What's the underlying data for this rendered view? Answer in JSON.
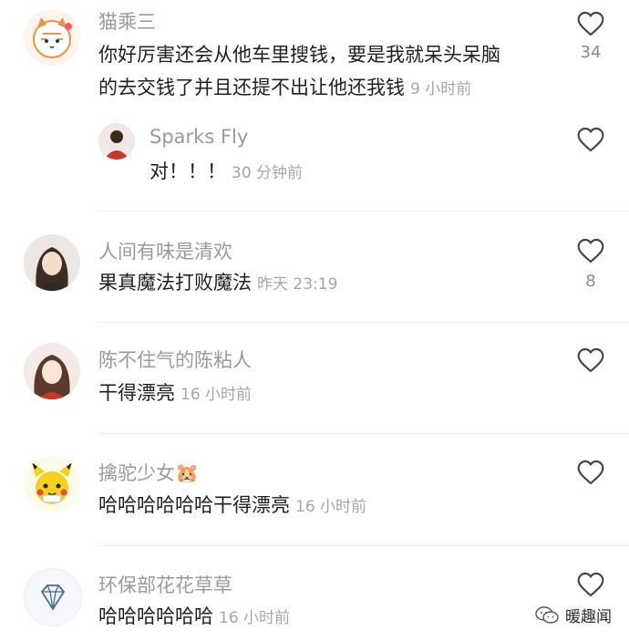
{
  "comments": [
    {
      "name": "猫乘三",
      "text": "你好厉害还会从他车里搜钱，要是我就呆头呆脑的去交钱了并且还提不出让他还我钱",
      "time": "9 小时前",
      "likes": "34",
      "avatar_icon": "cat-cartoon-icon",
      "reply": {
        "name": "Sparks Fly",
        "text": "对！！！",
        "time": "30 分钟前",
        "avatar_icon": "user-photo-icon"
      }
    },
    {
      "name": "人间有味是清欢",
      "text": "果真魔法打败魔法",
      "time": "昨天 23:19",
      "likes": "8",
      "avatar_icon": "user-photo-icon"
    },
    {
      "name": "陈不住气的陈粘人",
      "text": "干得漂亮",
      "time": "16 小时前",
      "avatar_icon": "user-photo-icon"
    },
    {
      "name": "擒驼少女🐹",
      "text": "哈哈哈哈哈哈干得漂亮",
      "time": "16 小时前",
      "avatar_icon": "pikachu-icon"
    },
    {
      "name": "环保部花花草草",
      "text": "哈哈哈哈哈哈",
      "time": "16 小时前",
      "avatar_icon": "diamond-icon"
    }
  ],
  "watermark": {
    "label": "暖趣闻",
    "icon": "wechat-icon"
  },
  "colors": {
    "name": "#9a9a9a",
    "text": "#1f1f1f",
    "time": "#a6a6a6",
    "divider": "#efefef"
  }
}
